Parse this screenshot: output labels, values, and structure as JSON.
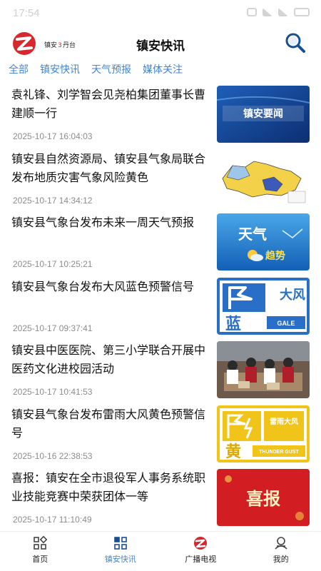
{
  "status": {
    "time": "17:54"
  },
  "header": {
    "title": "镇安快讯",
    "logo_text": "镇安3丹台"
  },
  "tabs": [
    {
      "label": "全部"
    },
    {
      "label": "镇安快讯"
    },
    {
      "label": "天气预报"
    },
    {
      "label": "媒体关注"
    }
  ],
  "news": [
    {
      "title": "袁礼锋、刘学智会见尧柏集团董事长曹建顺一行",
      "time": "2025-10-17 16:04:03",
      "thumb_text": "镇安要闻"
    },
    {
      "title": "镇安县自然资源局、镇安县气象局联合发布地质灾害气象风险黄色",
      "time": "2025-10-17 14:34:12",
      "thumb_text": ""
    },
    {
      "title": "镇安县气象台发布未来一周天气预报",
      "time": "2025-10-17 10:25:21",
      "thumb_text": "天气",
      "thumb_text2": "趋势"
    },
    {
      "title": "镇安县气象台发布大风蓝色预警信号",
      "time": "2025-10-17 09:37:41",
      "thumb_text": "大风",
      "thumb_text2": "蓝",
      "thumb_text3": "GALE"
    },
    {
      "title": "镇安县中医医院、第三小学联合开展中医药文化进校园活动",
      "time": "2025-10-17 10:41:53",
      "thumb_text": ""
    },
    {
      "title": "镇安县气象台发布雷雨大风黄色预警信号",
      "time": "2025-10-16 22:38:53",
      "thumb_text": "雷雨大风",
      "thumb_text2": "黄",
      "thumb_text3": "THUNDER GUST"
    },
    {
      "title": "喜报：镇安在全市退役军人事务系统职业技能竞赛中荣获团体一等",
      "time": "2025-10-17 11:10:49",
      "thumb_text": "喜报"
    }
  ],
  "nav": [
    {
      "label": "首页",
      "icon": "home-grid-icon"
    },
    {
      "label": "镇安快讯",
      "icon": "news-grid-icon"
    },
    {
      "label": "广播电视",
      "icon": "broadcast-logo-icon"
    },
    {
      "label": "我的",
      "icon": "profile-icon"
    }
  ],
  "colors": {
    "accent": "#3f86d6",
    "brand_red": "#d6282d",
    "time_gray": "#8c8c8c"
  }
}
